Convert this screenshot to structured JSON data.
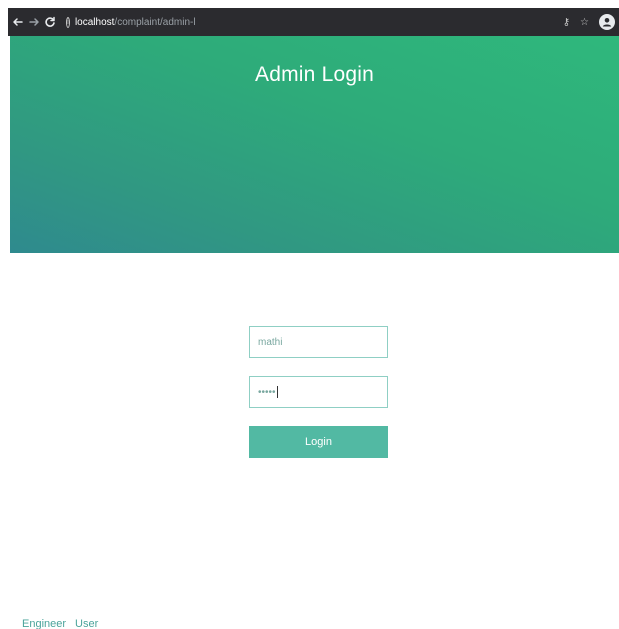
{
  "browser": {
    "url_host": "localhost",
    "url_path": "/complaint/admin-login.php"
  },
  "hero": {
    "title": "Admin Login"
  },
  "login": {
    "username_value": "mathi",
    "password_value": "•••••",
    "button_label": "Login"
  },
  "footer": {
    "links": [
      "Engineer",
      "User"
    ]
  },
  "colors": {
    "chrome_bg": "#2b2b2f",
    "hero_gradient_start": "#2fb87c",
    "hero_gradient_end": "#2f8a8e",
    "accent": "#52b9a3",
    "input_border": "#8fcfc4",
    "link": "#4aa39a"
  },
  "icons": {
    "back": "back-arrow-icon",
    "forward": "forward-arrow-icon",
    "reload": "reload-icon",
    "info": "info-icon",
    "key": "key-icon",
    "star": "star-icon",
    "account": "account-icon"
  }
}
